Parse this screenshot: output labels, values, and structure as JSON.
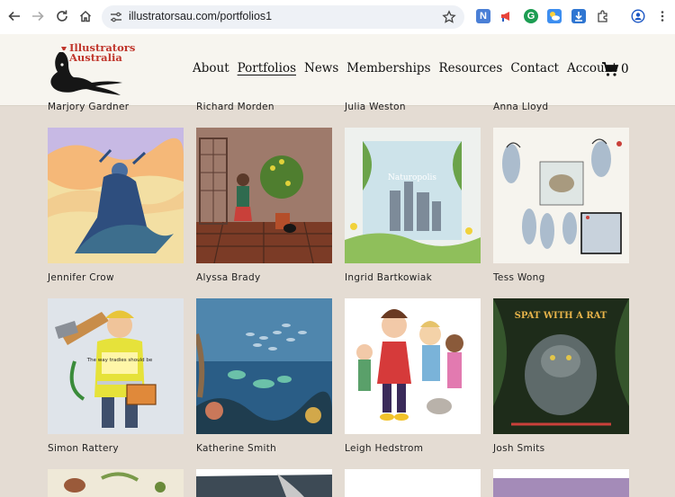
{
  "browser": {
    "url": "illustratorsau.com/portfolios1"
  },
  "site": {
    "logo_line1": "Illustrators",
    "logo_line2": "Australia",
    "menu": [
      "About",
      "Portfolios",
      "News",
      "Memberships",
      "Resources",
      "Contact",
      "Account"
    ],
    "active_menu": "Portfolios",
    "cart_count": "0"
  },
  "portfolio": {
    "prev_row_names": [
      "Marjory Gardner",
      "Richard Morden",
      "Julia Weston",
      "Anna Lloyd"
    ],
    "rows": [
      [
        "Jennifer Crow",
        "Alyssa Brady",
        "Ingrid Bartkowiak",
        "Tess Wong"
      ],
      [
        "Simon Rattery",
        "Katherine Smith",
        "Leigh Hedstrom",
        "Josh Smits"
      ]
    ],
    "artwork_text": {
      "hi_vis_vest": "The way tradies should be",
      "book_title": "Naturopolis",
      "spat_title": "SPAT WITH A RAT"
    }
  },
  "colors": {
    "page_bg": "#e4dcd3",
    "header_bg": "#f7f5ef",
    "logo_red": "#c0362c"
  }
}
